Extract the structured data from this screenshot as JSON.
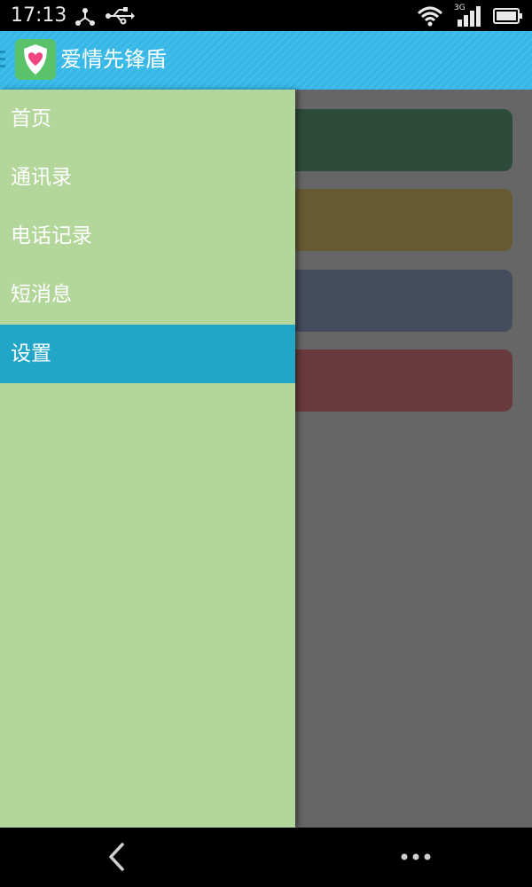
{
  "status_bar": {
    "time": "17:13",
    "icons": [
      "share-icon",
      "usb-icon",
      "wifi-icon",
      "3g-signal-icon",
      "battery-icon"
    ],
    "network_label": "3G"
  },
  "app_bar": {
    "title": "爱情先锋盾",
    "icon": "heart-shield-icon"
  },
  "drawer": {
    "items": [
      {
        "label": "首页",
        "active": false
      },
      {
        "label": "通讯录",
        "active": false
      },
      {
        "label": "电话记录",
        "active": false
      },
      {
        "label": "短消息",
        "active": false
      },
      {
        "label": "设置",
        "active": true
      }
    ]
  },
  "content": {
    "cards": [
      {
        "color": "#2d4b3a"
      },
      {
        "color": "#675a33"
      },
      {
        "color": "#454c5d"
      },
      {
        "color": "#693a3d"
      }
    ]
  },
  "colors": {
    "app_bar": "#34b6e6",
    "drawer_bg": "#b3d79b",
    "drawer_active": "#22a6c8",
    "overlay": "#666666"
  },
  "nav_bar": {
    "icons": [
      "back-icon",
      "more-icon"
    ]
  }
}
